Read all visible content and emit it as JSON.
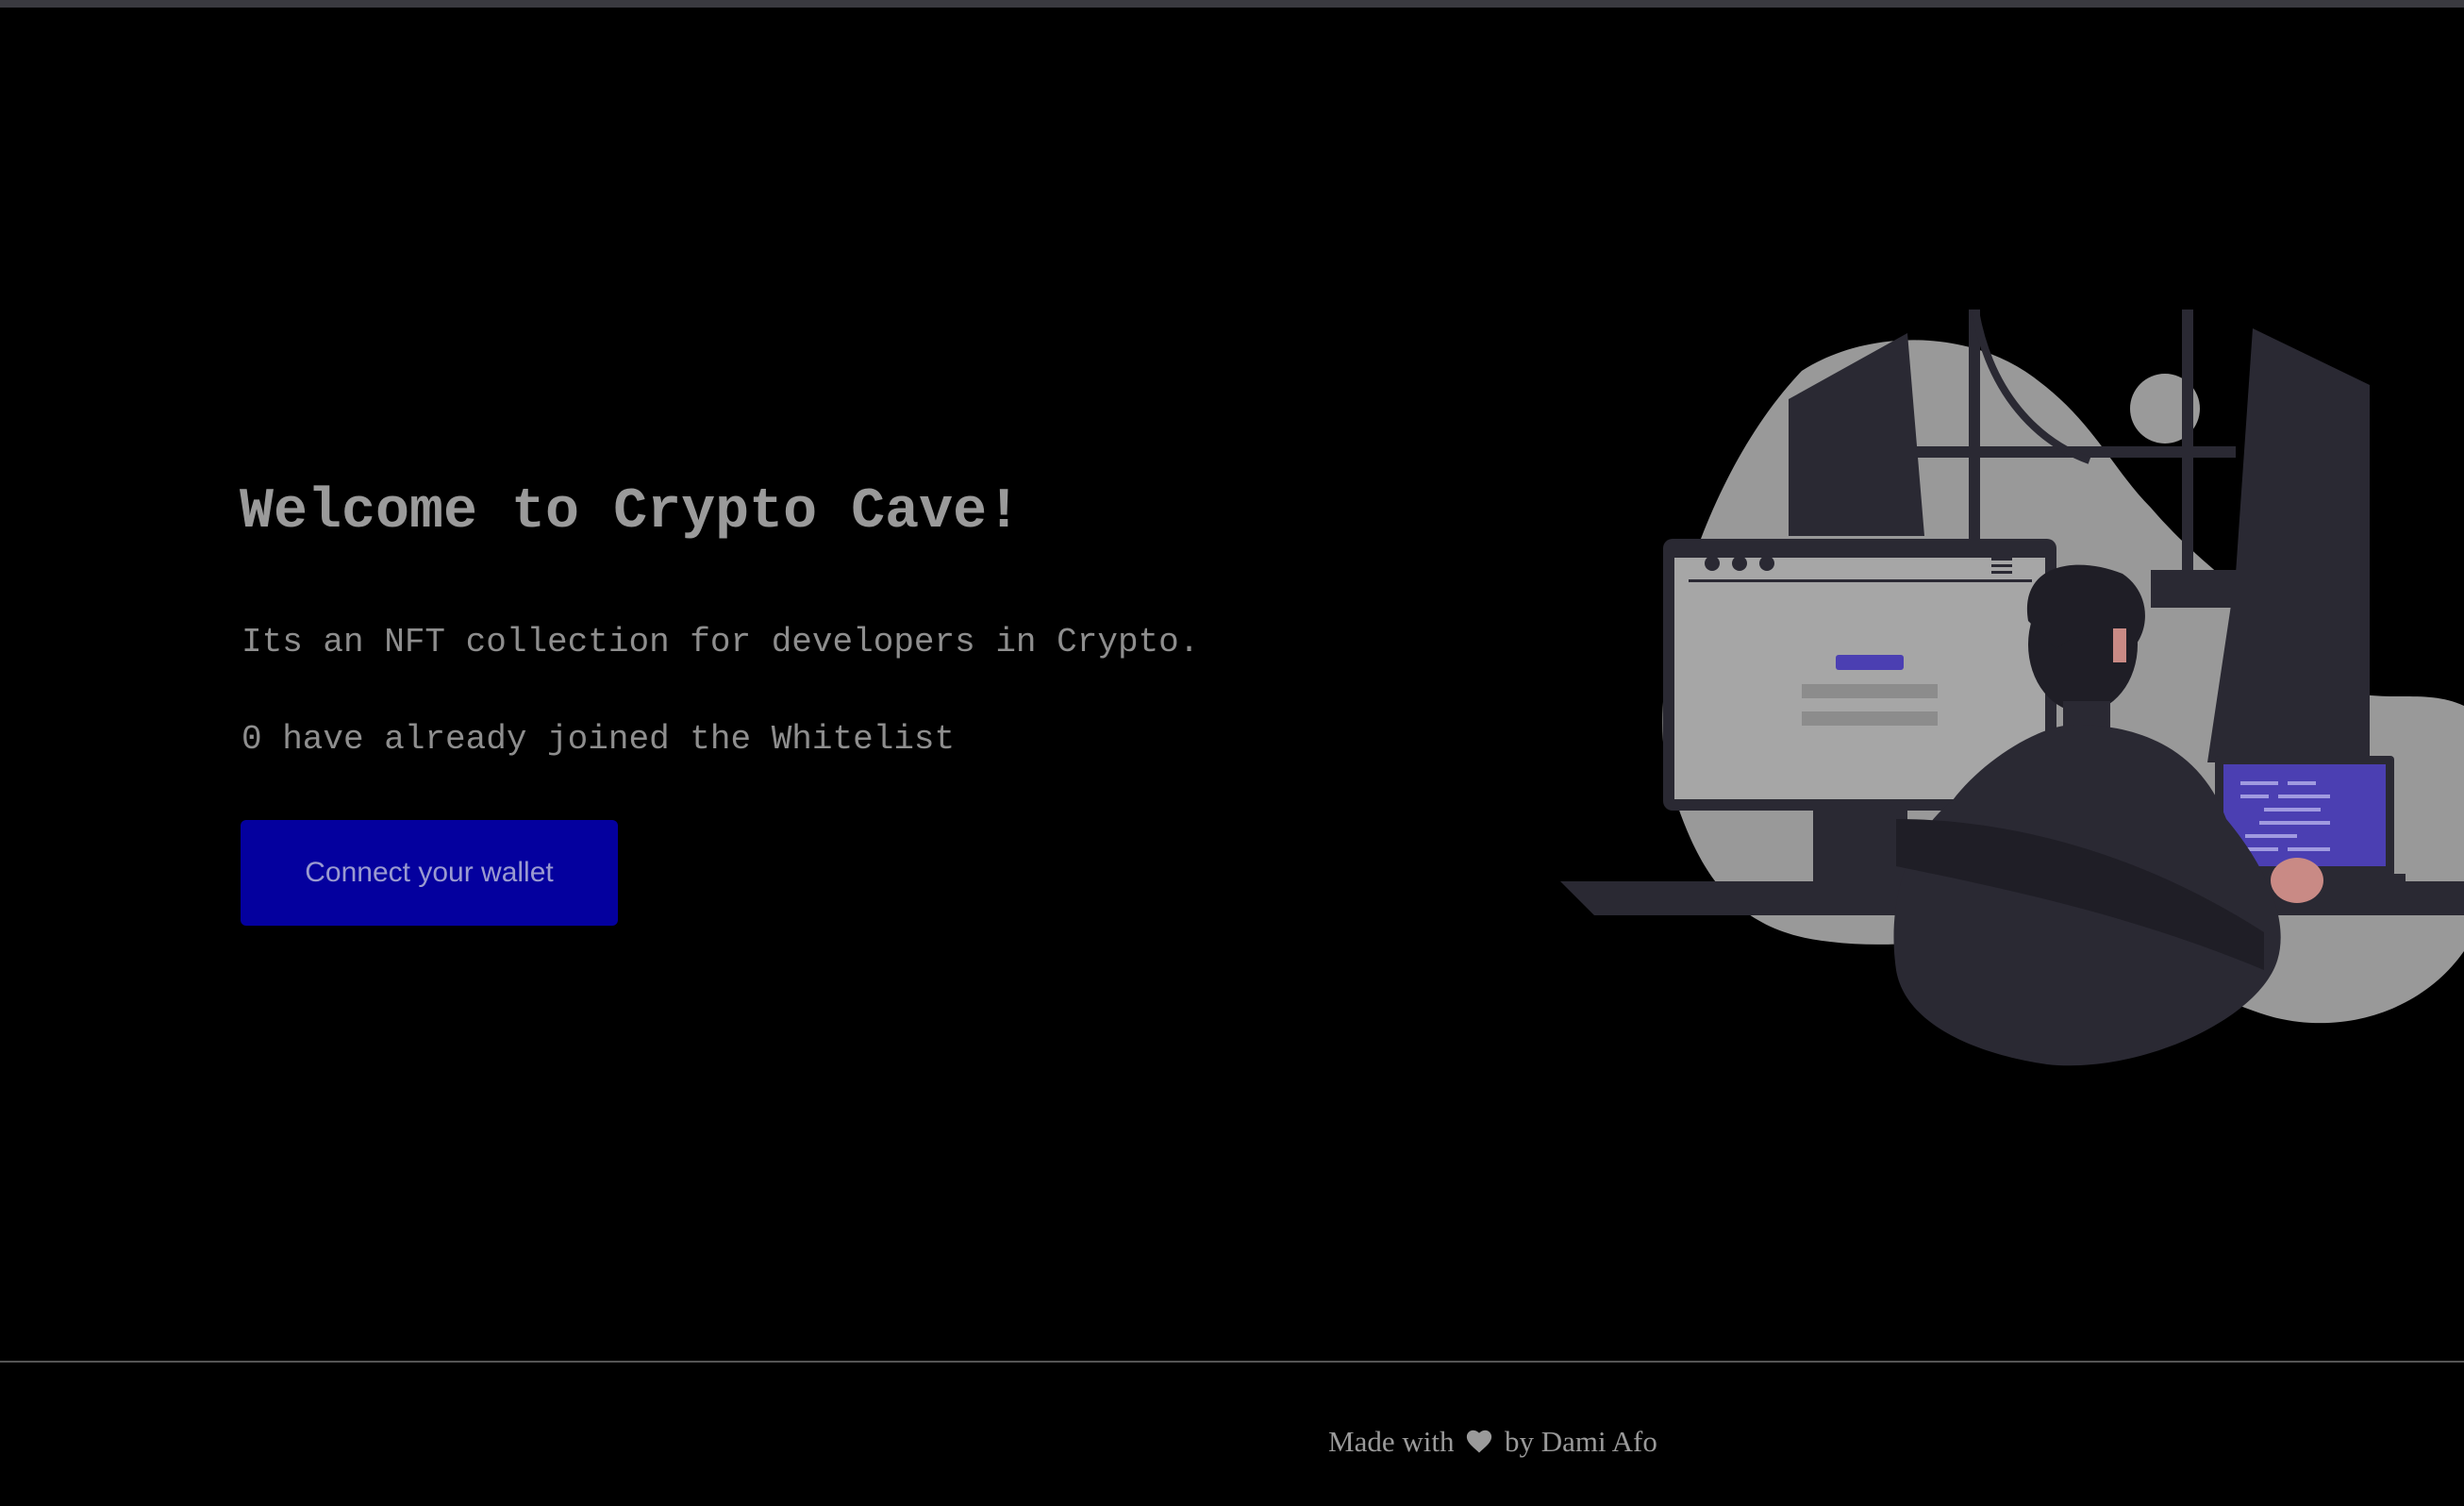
{
  "hero": {
    "title": "Welcome to Crypto Cave!",
    "description": "Its an NFT collection for developers in Crypto.",
    "whitelist_text": "0 have already joined the Whitelist",
    "connect_button_label": "Connect your wallet"
  },
  "illustration": {
    "name": "developer-at-desk-illustration",
    "accent_color": "#4b3fb2"
  },
  "footer": {
    "prefix": "Made with",
    "icon": "heart-icon",
    "suffix": "by Dami Afo"
  },
  "colors": {
    "background": "#000000",
    "button": "#04009e",
    "text": "#9a9a9a"
  }
}
